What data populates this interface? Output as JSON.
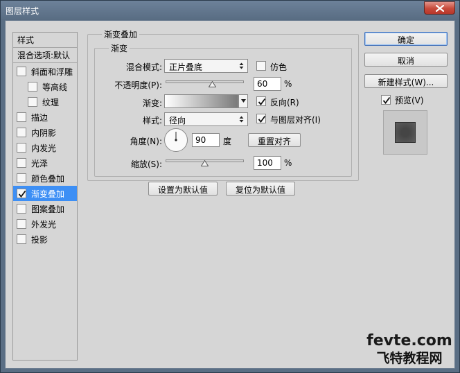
{
  "window": {
    "title": "图层样式"
  },
  "colors": {
    "selection": "#3d8ff5",
    "dialog_bg": "#d6d6d6",
    "title_bar": "#5a6e84",
    "close_red": "#c7493a"
  },
  "sidebar": {
    "header": "样式",
    "blending_options": "混合选项:默认",
    "items": [
      {
        "label": "斜面和浮雕",
        "checked": false
      },
      {
        "label": "等高线",
        "checked": false
      },
      {
        "label": "纹理",
        "checked": false
      },
      {
        "label": "描边",
        "checked": false
      },
      {
        "label": "内阴影",
        "checked": false
      },
      {
        "label": "内发光",
        "checked": false
      },
      {
        "label": "光泽",
        "checked": false
      },
      {
        "label": "颜色叠加",
        "checked": false
      },
      {
        "label": "渐变叠加",
        "checked": true,
        "selected": true
      },
      {
        "label": "图案叠加",
        "checked": false
      },
      {
        "label": "外发光",
        "checked": false
      },
      {
        "label": "投影",
        "checked": false
      }
    ]
  },
  "panel": {
    "section_title": "渐变叠加",
    "group_title": "渐变",
    "blend_mode_label": "混合模式:",
    "blend_mode_value": "正片叠底",
    "dither_label": "仿色",
    "dither_checked": false,
    "opacity_label": "不透明度(P):",
    "opacity_value": "60",
    "opacity_fraction": 0.6,
    "opacity_unit": "%",
    "gradient_label": "渐变:",
    "reverse_label": "反向(R)",
    "reverse_checked": true,
    "style_label": "样式:",
    "style_value": "径向",
    "align_label": "与图层对齐(I)",
    "align_checked": true,
    "angle_label": "角度(N):",
    "angle_value": "90",
    "angle_unit": "度",
    "reset_align_label": "重置对齐",
    "scale_label": "缩放(S):",
    "scale_value": "100",
    "scale_fraction": 0.5,
    "scale_unit": "%",
    "make_default_label": "设置为默认值",
    "reset_default_label": "复位为默认值"
  },
  "buttons": {
    "ok": "确定",
    "cancel": "取消",
    "new_style": "新建样式(W)...",
    "preview_label": "预览(V)",
    "preview_checked": true
  },
  "icons": {
    "close": "close-icon",
    "check": "checkmark-icon",
    "arrows": "updown-arrows-icon"
  },
  "watermark": {
    "line1": "fevte.com",
    "line2": "飞特教程网"
  }
}
